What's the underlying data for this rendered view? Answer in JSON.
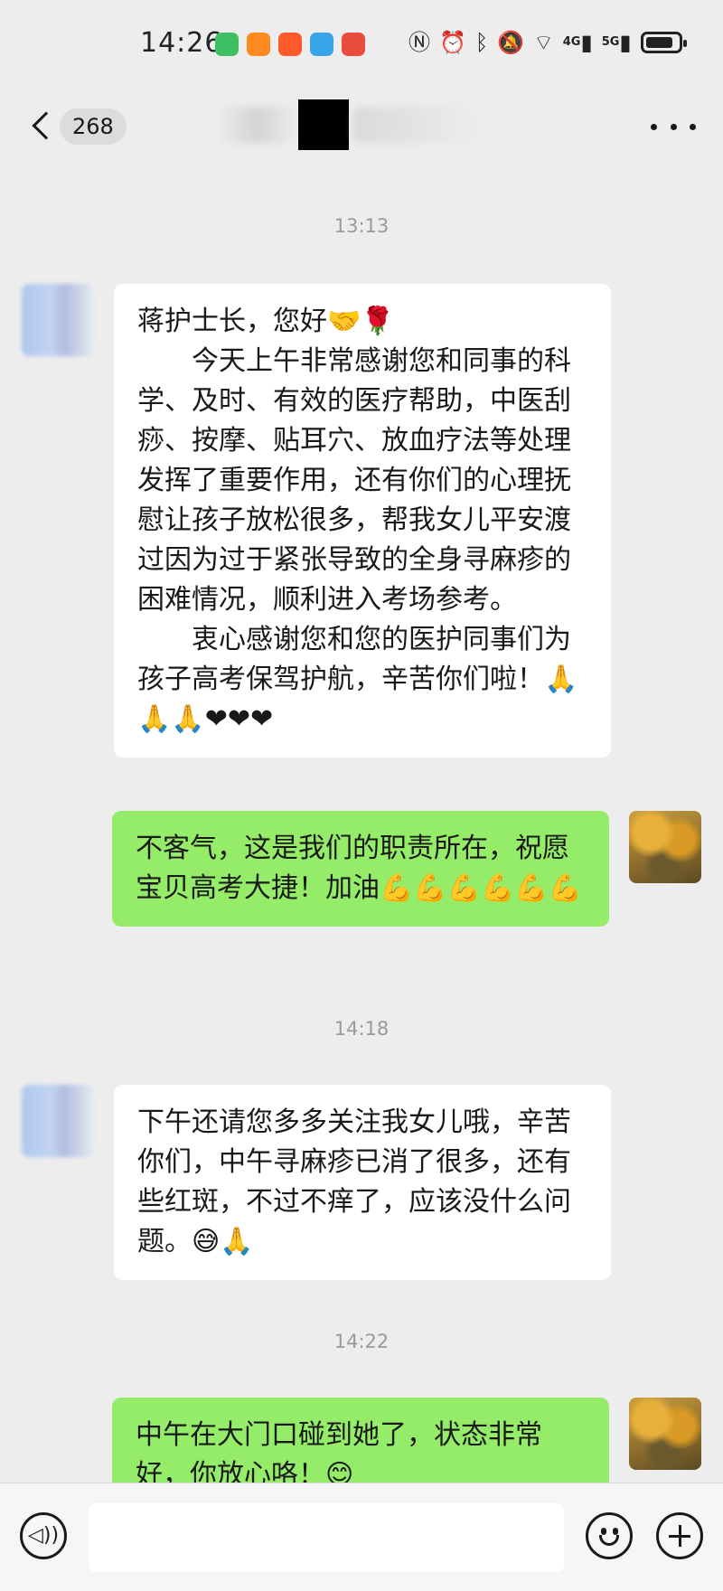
{
  "status_bar": {
    "time": "14:26",
    "app_icon_colors": [
      "#3fbf64",
      "#ff8a1f",
      "#ff5a2a",
      "#37a5e8",
      "#e94c3d"
    ],
    "network_labels": [
      "4G",
      "5G"
    ],
    "icons": [
      "nfc-icon",
      "alarm-icon",
      "bluetooth-icon",
      "mute-icon",
      "wifi-icon",
      "signal-icon",
      "battery-icon"
    ],
    "battery_level": 0.85
  },
  "nav": {
    "back_icon": "chevron-left-icon",
    "unread_count": "268",
    "more_icon": "more-dots-icon"
  },
  "messages": [
    {
      "time": "13:13",
      "side": "in",
      "paragraphs": [
        "蒋护士长，您好🤝🌹",
        "　　今天上午非常感谢您和同事的科学、及时、有效的医疗帮助，中医刮痧、按摩、贴耳穴、放血疗法等处理发挥了重要作用，还有你们的心理抚慰让孩子放松很多，帮我女儿平安渡过因为过于紧张导致的全身寻麻疹的困难情况，顺利进入考场参考。",
        "　　衷心感谢您和您的医护同事们为孩子高考保驾护航，辛苦你们啦！🙏🙏🙏❤❤❤"
      ]
    },
    {
      "side": "out",
      "paragraphs": [
        "不客气，这是我们的职责所在，祝愿宝贝高考大捷！加油💪💪💪💪💪💪"
      ]
    },
    {
      "time": "14:18",
      "side": "in",
      "paragraphs": [
        "下午还请您多多关注我女儿哦，辛苦你们，中午寻麻疹已消了很多，还有些红斑，不过不痒了，应该没什么问题。😅🙏"
      ]
    },
    {
      "time": "14:22",
      "side": "out",
      "paragraphs": [
        "中午在大门口碰到她了，状态非常好，你放心咯！😊"
      ]
    }
  ],
  "input_bar": {
    "voice_icon": "voice-icon",
    "emoji_icon": "emoji-icon",
    "add_icon": "plus-icon",
    "placeholder": ""
  },
  "colors": {
    "background": "#ededed",
    "incoming_bubble": "#ffffff",
    "outgoing_bubble": "#95ec69",
    "timestamp": "#9a9a9a"
  }
}
